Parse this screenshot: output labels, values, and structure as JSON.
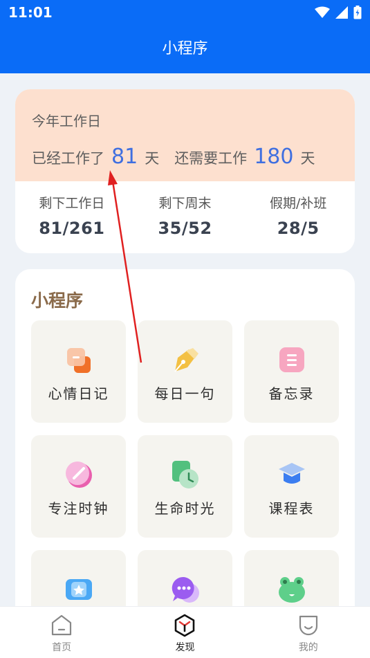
{
  "status_bar": {
    "time": "11:01"
  },
  "header": {
    "title": "小程序"
  },
  "workday_card": {
    "title": "今年工作日",
    "worked_prefix": "已经工作了",
    "worked_days": "81",
    "day_unit": "天",
    "remaining_prefix": "还需要工作",
    "remaining_days": "180",
    "stats": [
      {
        "label": "剩下工作日",
        "value": "81/261"
      },
      {
        "label": "剩下周末",
        "value": "35/52"
      },
      {
        "label": "假期/补班",
        "value": "28/5"
      }
    ]
  },
  "mini_programs": {
    "title": "小程序",
    "items": [
      {
        "label": "心情日记",
        "icon": "mood-diary-icon"
      },
      {
        "label": "每日一句",
        "icon": "daily-quote-icon"
      },
      {
        "label": "备忘录",
        "icon": "memo-icon"
      },
      {
        "label": "专注时钟",
        "icon": "focus-clock-icon"
      },
      {
        "label": "生命时光",
        "icon": "life-time-icon"
      },
      {
        "label": "课程表",
        "icon": "schedule-icon"
      },
      {
        "label": "",
        "icon": "ticket-star-icon"
      },
      {
        "label": "",
        "icon": "chat-bubble-icon"
      },
      {
        "label": "",
        "icon": "frog-icon"
      }
    ]
  },
  "bottom_nav": {
    "items": [
      {
        "label": "首页",
        "icon": "home-icon"
      },
      {
        "label": "发现",
        "icon": "discover-icon"
      },
      {
        "label": "我的",
        "icon": "profile-icon"
      }
    ],
    "active_index": 1
  },
  "colors": {
    "brand": "#0a6cf7",
    "card_peach": "#fde0cf",
    "number_blue": "#3f6fe0",
    "section_title": "#8a6a4a",
    "annotation_arrow": "#e02020"
  }
}
